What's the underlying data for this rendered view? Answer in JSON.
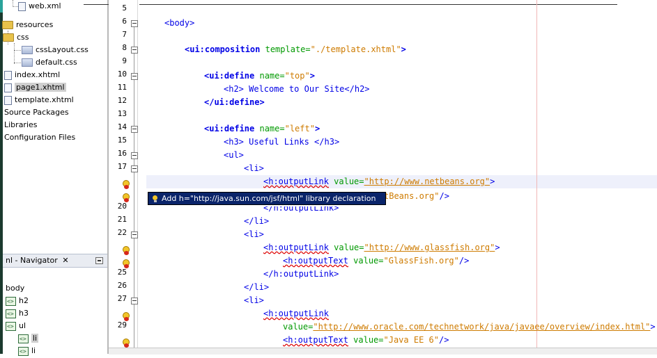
{
  "project_tree": {
    "items": [
      {
        "label": "web.xml",
        "icon": "xml-file-icon"
      },
      {
        "label": "resources",
        "icon": "folder-icon"
      },
      {
        "label": "css",
        "icon": "folder-icon"
      },
      {
        "label": "cssLayout.css",
        "icon": "css-file-icon"
      },
      {
        "label": "default.css",
        "icon": "css-file-icon"
      },
      {
        "label": "index.xhtml",
        "icon": "xhtml-file-icon"
      },
      {
        "label": "page1.xhtml",
        "icon": "xhtml-file-icon",
        "selected": true
      },
      {
        "label": "template.xhtml",
        "icon": "xhtml-file-icon"
      },
      {
        "label": "Source Packages"
      },
      {
        "label": "Libraries"
      },
      {
        "label": "Configuration Files"
      }
    ]
  },
  "navigator": {
    "title": "nl - Navigator",
    "close_glyph": "✕",
    "items": [
      "body",
      "h2",
      "h3",
      "ul",
      "li",
      "li"
    ]
  },
  "editor": {
    "line_numbers": [
      "5",
      "6",
      "7",
      "8",
      "9",
      "10",
      "11",
      "12",
      "13",
      "14",
      "15",
      "16",
      "17",
      "",
      "",
      "20",
      "21",
      "22",
      "",
      "",
      "25",
      "26",
      "27",
      "",
      "29",
      ""
    ],
    "lines": {
      "l6_body": "<body>",
      "l8_tag": "<ui:composition",
      "l8_attr": " template=",
      "l8_val": "\"./template.xhtml\"",
      "l8_end": ">",
      "l10_tag": "<ui:define",
      "l10_attr": " name=",
      "l10_val": "\"top\"",
      "l10_end": ">",
      "l11": "<h2> Welcome to Our Site</h2>",
      "l12": "</ui:define>",
      "l14_tag": "<ui:define",
      "l14_attr": " name=",
      "l14_val": "\"left\"",
      "l14_end": ">",
      "l15": "<h3> Useful Links </h3>",
      "l16": "<ul>",
      "l17": "<li>",
      "l18_tag": "<h:outputLink",
      "l18_attr": " value=",
      "l18_val": "\"http://www.netbeans.org\"",
      "l18_end": ">",
      "l19_val": "tBeans.org\"",
      "l19_end": "/>",
      "l20": "</h:outputLink>",
      "l21": "</li>",
      "l22": "<li>",
      "l23_tag": "<h:outputLink",
      "l23_attr": " value=",
      "l23_val": "\"http://www.glassfish.org\"",
      "l23_end": ">",
      "l24_tag": "<h:outputText",
      "l24_attr": " value=",
      "l24_val": "\"GlassFish.org\"",
      "l24_end": "/>",
      "l25": "</h:outputLink>",
      "l26": "</li>",
      "l27": "<li>",
      "l28": "<h:outputLink",
      "l29_attr": "value=",
      "l29_val": "\"http://www.oracle.com/technetwork/java/javaee/overview/index.html\"",
      "l29_end": ">",
      "l30_tag": "<h:outputText",
      "l30_attr": " value=",
      "l30_val": "\"Java EE 6\"",
      "l30_end": "/>"
    }
  },
  "tooltip": {
    "text": "Add h=\"http://java.sun.com/jsf/html\" library declaration",
    "icon": "lightbulb-icon"
  }
}
